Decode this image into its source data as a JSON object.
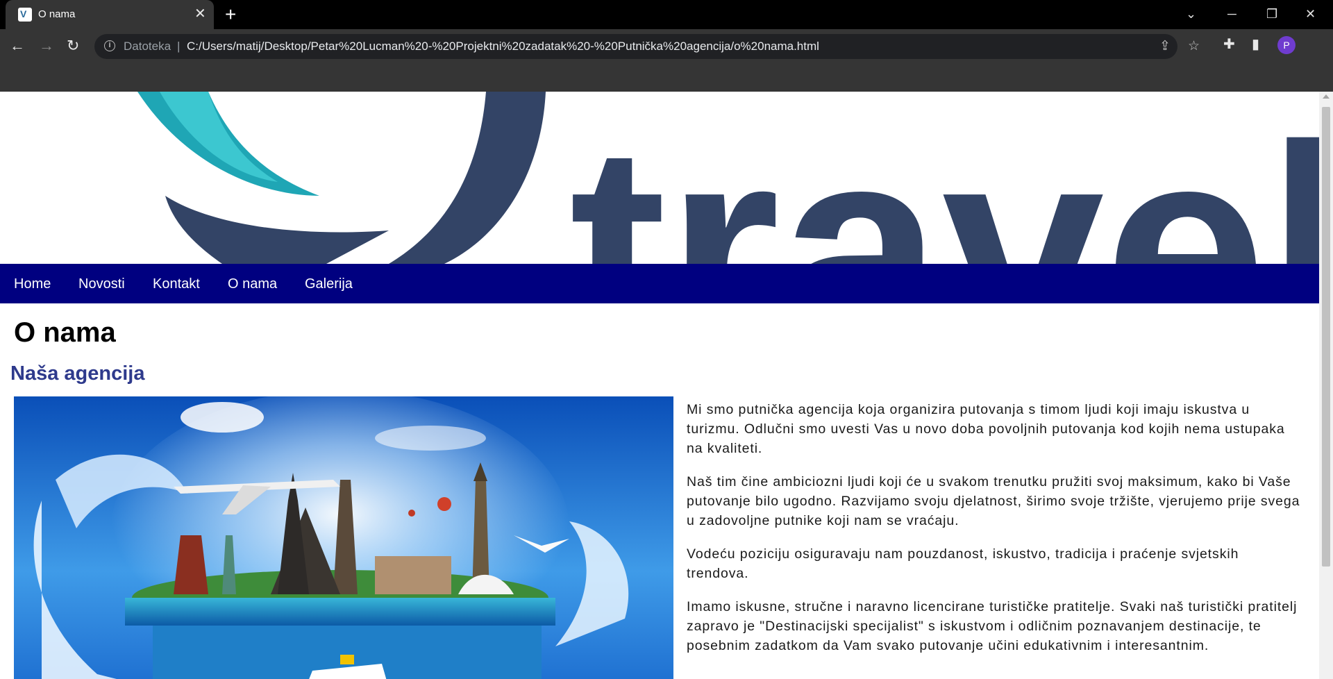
{
  "browser": {
    "tab_title": "O nama",
    "new_tab_label": "+",
    "tab_close": "✕",
    "url_scheme": "Datoteka",
    "url_separator": "|",
    "url": "C:/Users/matij/Desktop/Petar%20Lucman%20-%20Projektni%20zadatak%20-%20Putnička%20agencija/o%20nama.html",
    "profile_initial": "P",
    "back": "←",
    "forward": "→",
    "reload": "↻",
    "share": "⇪",
    "star": "☆",
    "extensions": "✚",
    "sidepanel": "▮",
    "tablist": "⌄",
    "minimize": "─",
    "restore": "❐",
    "close": "✕"
  },
  "site": {
    "banner_text": "travel",
    "nav": [
      "Home",
      "Novosti",
      "Kontakt",
      "O nama",
      "Galerija"
    ],
    "page_title": "O nama",
    "section_title": "Naša agencija",
    "paragraphs": [
      "Mi smo putnička agencija koja organizira putovanja s timom ljudi koji imaju iskustva u turizmu. Odlučni smo uvesti Vas u novo doba povoljnih putovanja kod kojih nema ustupaka na kvaliteti.",
      "Naš tim čine ambiciozni ljudi koji će u svakom trenutku pružiti svoj maksimum, kako bi Vaše putovanje bilo ugodno. Razvijamo svoju djelatnost, širimo svoje tržište, vjerujemo prije svega u zadovoljne putnike koji nam se vraćaju.",
      "Vodeću poziciju osiguravaju nam pouzdanost, iskustvo, tradicija i praćenje svjetskih trendova.",
      "Imamo iskusne, stručne i naravno licencirane turističke pratitelje. Svaki naš turistički pratitelj zapravo je \"Destinacijski specijalist\" s iskustvom i odličnim poznavanjem destinacije, te posebnim zadatkom da Vam svako putovanje učini edukativnim i interesantnim."
    ]
  },
  "colors": {
    "navbar": "#000080",
    "section_title": "#2e3a8c",
    "logo_navy": "#334466",
    "logo_teal": "#2ab7c4"
  }
}
